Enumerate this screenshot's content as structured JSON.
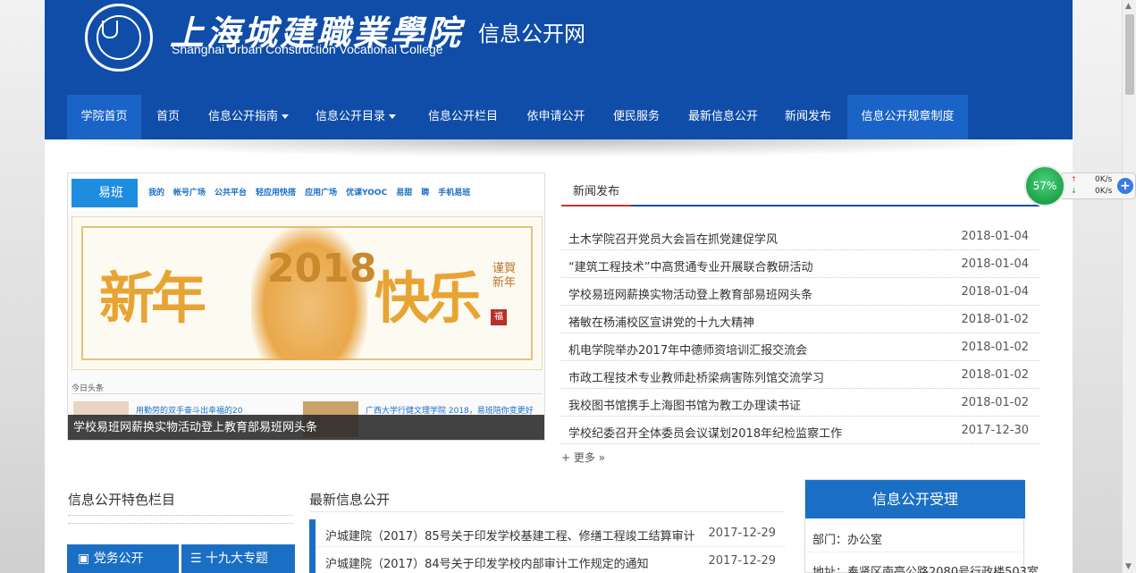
{
  "header": {
    "college_name_cn": "上海城建職業學院",
    "college_name_en": "Shanghai Urban Construction Vocational College",
    "site_title": "信息公开网"
  },
  "nav": {
    "items": [
      {
        "label": "学院首页",
        "active": true
      },
      {
        "label": "首页"
      },
      {
        "label": "信息公开指南",
        "dropdown": true
      },
      {
        "label": "信息公开目录",
        "dropdown": true
      },
      {
        "label": "信息公开栏目"
      },
      {
        "label": "依申请公开"
      },
      {
        "label": "便民服务"
      },
      {
        "label": "最新信息公开"
      },
      {
        "label": "新闻发布"
      },
      {
        "label": "信息公开规章制度",
        "active": true
      }
    ]
  },
  "slideshow": {
    "caption": "学校易班网薪换实物活动登上教育部易班网头条",
    "yiban_logo": "易班",
    "yiban_nav": [
      "我的",
      "帐号广场",
      "公共平台",
      "轻应用快搭",
      "应用广场",
      "优课YOOC",
      "易甜",
      "聘",
      "手机易班"
    ],
    "banner_left": "新年",
    "banner_year": "2018",
    "banner_right": "快乐",
    "banner_greeting": "谨賀新年",
    "banner_seal": "福",
    "headlines_label": "今日头条",
    "headline_snippet_1": "用勤劳的双手奋斗出幸福的20",
    "headline_snippet_2": "广西大学行健文理学院 2018，易班陪你变更好"
  },
  "news": {
    "tab_label": "新闻发布",
    "items": [
      {
        "title": "土木学院召开党员大会旨在抓党建促学风",
        "date": "2018-01-04"
      },
      {
        "title": "“建筑工程技术”中高贯通专业开展联合教研活动",
        "date": "2018-01-04"
      },
      {
        "title": "学校易班网薪换实物活动登上教育部易班网头条",
        "date": "2018-01-04"
      },
      {
        "title": "褚敏在杨浦校区宣讲党的十九大精神",
        "date": "2018-01-02"
      },
      {
        "title": "机电学院举办2017年中德师资培训汇报交流会",
        "date": "2018-01-02"
      },
      {
        "title": "市政工程技术专业教师赴桥梁病害陈列馆交流学习",
        "date": "2018-01-02"
      },
      {
        "title": "我校图书馆携手上海图书馆为教工办理读书证",
        "date": "2018-01-02"
      },
      {
        "title": "学校纪委召开全体委员会议谋划2018年纪检监察工作",
        "date": "2017-12-30"
      }
    ],
    "more_label": "更多 »"
  },
  "featured": {
    "title": "信息公开特色栏目",
    "buttons": [
      "党务公开",
      "十九大专题"
    ]
  },
  "latest": {
    "title": "最新信息公开",
    "items": [
      {
        "title": "沪城建院（2017）85号关于印发学校基建工程、修缮工程竣工结算审计",
        "date": "2017-12-29"
      },
      {
        "title": "沪城建院（2017）84号关于印发学校内部审计工作规定的通知",
        "date": "2017-12-29"
      }
    ]
  },
  "acceptance": {
    "title": "信息公开受理",
    "department": "部门：办公室",
    "address": "地址：奉贤区南亭公路2080号行政楼503室"
  },
  "speed_widget": {
    "percent": "57%",
    "up": "0K/s",
    "down": "0K/s"
  }
}
